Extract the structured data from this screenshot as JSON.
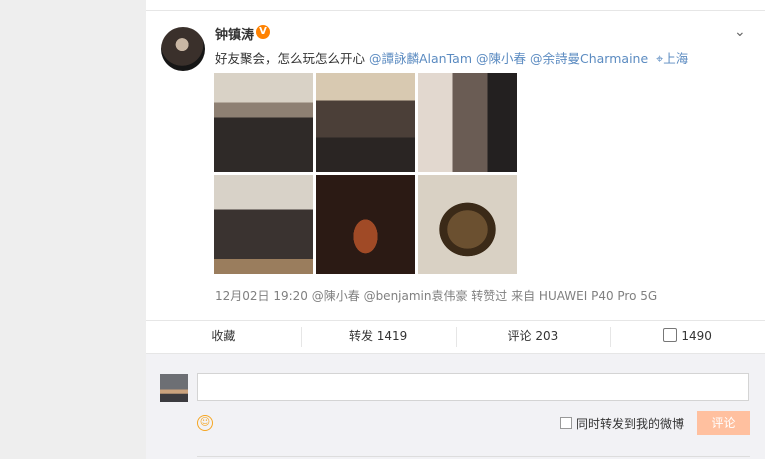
{
  "post": {
    "username": "钟镇涛",
    "verified_badge": "V",
    "text_plain": "好友聚会，怎么玩怎么开心",
    "mentions": [
      "@譚詠麟AlanTam",
      "@陳小春",
      "@余詩曼Charmaine"
    ],
    "location": "上海",
    "meta": "12月02日 19:20 @陳小春 @benjamin袁伟豪 转赞过  来自 HUAWEI P40 Pro 5G"
  },
  "actions": {
    "favorite": "收藏",
    "repost": "转发 1419",
    "comment": "评论 203",
    "like": "1490"
  },
  "comment_box": {
    "placeholder": "",
    "checkbox_label": "同时转发到我的微博",
    "submit": "评论"
  },
  "colors": {
    "link": "#5b8bc1",
    "brand_orange": "#ff8200",
    "submit_bg": "#ffc09f"
  }
}
